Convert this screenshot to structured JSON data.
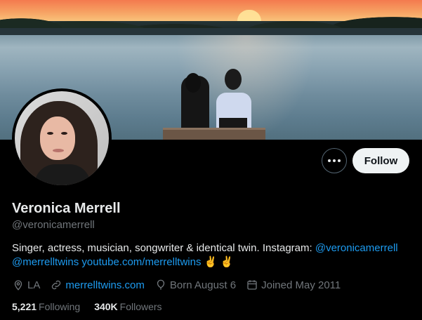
{
  "profile": {
    "name": "Veronica Merrell",
    "handle": "@veronicamerrell",
    "bio": {
      "text1": "Singer, actress, musician, songwriter & identical twin. Instagram: ",
      "mention1": "@veronicamerrell",
      "mention2": "@merrelltwins",
      "link": "youtube.com/merrelltwins",
      "emoji": "✌️ ✌️"
    },
    "location": "LA",
    "website": "merrelltwins.com",
    "birthday": "Born August 6",
    "joined": "Joined May 2011",
    "following_count": "5,221",
    "following_label": "Following",
    "followers_count": "340K",
    "followers_label": "Followers"
  },
  "actions": {
    "follow_label": "Follow",
    "more_icon": "more-horizontal-icon"
  },
  "colors": {
    "background": "#000000",
    "text_primary": "#e7e9ea",
    "text_secondary": "#71767b",
    "link": "#1d9bf0",
    "follow_button_bg": "#eff3f4"
  }
}
